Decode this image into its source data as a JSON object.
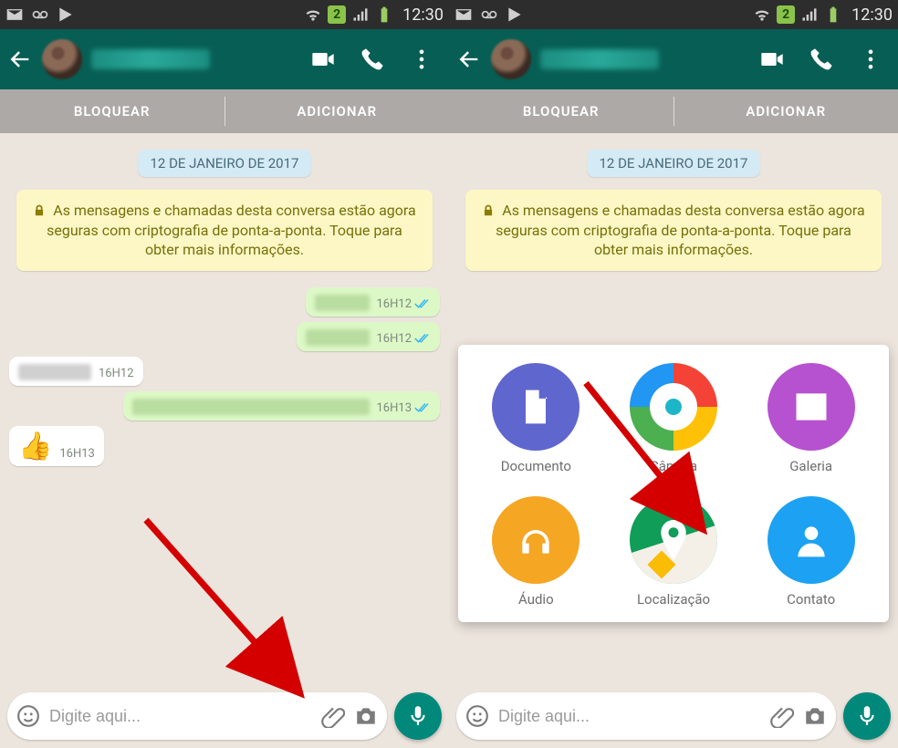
{
  "status": {
    "time": "12:30",
    "sim": "2"
  },
  "appbar": {},
  "actions": {
    "block": "BLOQUEAR",
    "add": "ADICIONAR"
  },
  "chat": {
    "date": "12 DE JANEIRO DE 2017",
    "encryption": "As mensagens e chamadas desta conversa estão agora seguras com criptografia de ponta-a-ponta. Toque para obter mais informações.",
    "msgs": [
      {
        "time": "16H12"
      },
      {
        "time": "16H12"
      },
      {
        "time": "16H12"
      },
      {
        "time": "16H13"
      },
      {
        "time": "16H13"
      }
    ]
  },
  "input": {
    "placeholder": "Digite aqui..."
  },
  "attach": {
    "doc": "Documento",
    "cam": "Câmera",
    "gal": "Galeria",
    "aud": "Áudio",
    "loc": "Localização",
    "con": "Contato"
  }
}
